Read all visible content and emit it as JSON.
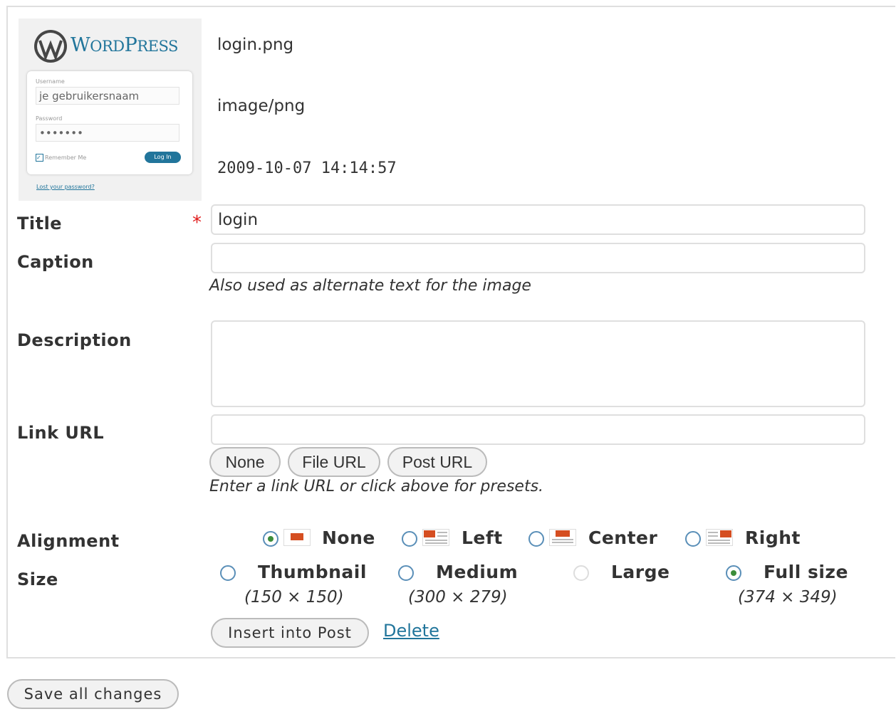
{
  "thumbnail": {
    "brand_word": "WordPress",
    "username_label": "Username",
    "username_value": "je gebruikersnaam",
    "password_label": "Password",
    "password_value": "•••••••",
    "remember_label": "Remember Me",
    "login_button": "Log In",
    "lost_password": "Lost your password?"
  },
  "file": {
    "name": "login.png",
    "type": "image/png",
    "date": "2009-10-07 14:14:57"
  },
  "form": {
    "title_label": "Title",
    "title_value": "login",
    "caption_label": "Caption",
    "caption_value": "",
    "caption_hint": "Also used as alternate text for the image",
    "description_label": "Description",
    "description_value": "",
    "link_label": "Link URL",
    "link_value": "",
    "link_buttons": [
      "None",
      "File URL",
      "Post URL"
    ],
    "link_hint": "Enter a link URL or click above for presets.",
    "alignment_label": "Alignment",
    "alignment_options": [
      "None",
      "Left",
      "Center",
      "Right"
    ],
    "alignment_selected": "None",
    "size_label": "Size",
    "size_options": [
      {
        "label": "Thumbnail",
        "dims": "(150 × 150)"
      },
      {
        "label": "Medium",
        "dims": "(300 × 279)"
      },
      {
        "label": "Large",
        "dims": ""
      },
      {
        "label": "Full size",
        "dims": "(374 × 349)"
      }
    ],
    "size_selected": "Full size",
    "insert_button": "Insert into Post",
    "delete_link": "Delete"
  },
  "footer": {
    "save_button": "Save all changes"
  },
  "colors": {
    "link": "#21759b",
    "required": "#e01a1a",
    "radio_checked": "#3b8d3b",
    "align_icon": "#d54e21"
  }
}
